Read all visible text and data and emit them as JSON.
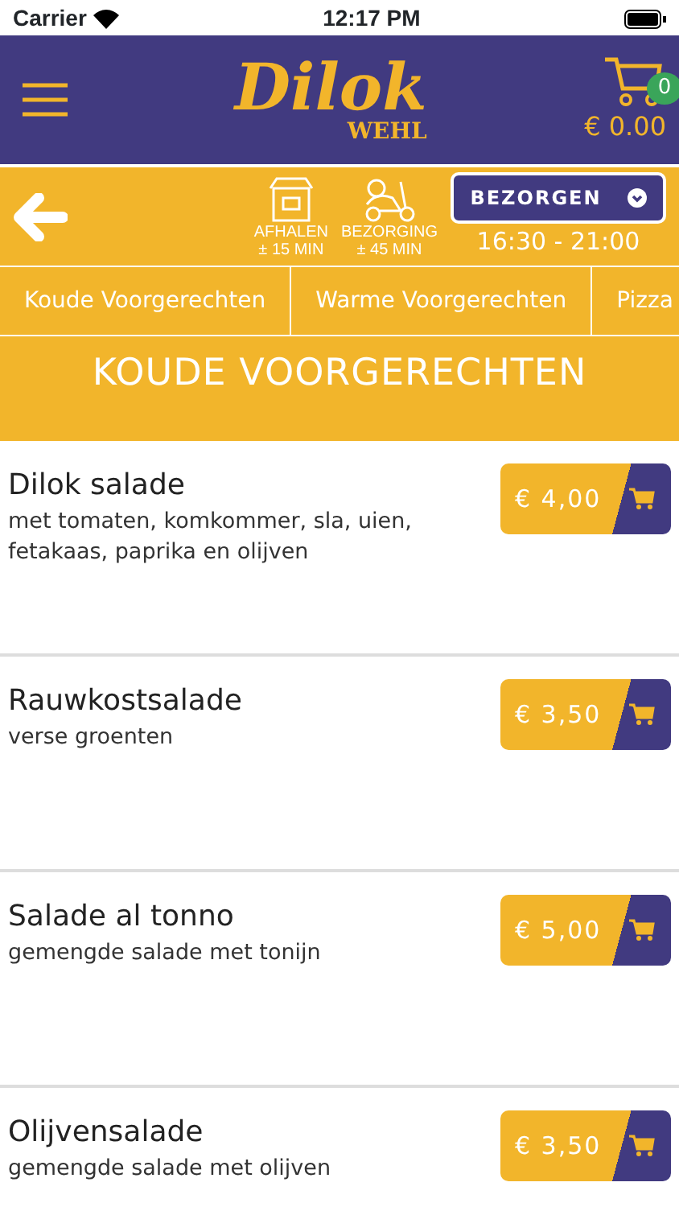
{
  "status_bar": {
    "carrier": "Carrier",
    "time": "12:17 PM"
  },
  "header": {
    "logo": "Dilok",
    "logo_sub": "WEHL",
    "cart_count": "0",
    "cart_total": "€ 0.00"
  },
  "order_bar": {
    "options": [
      {
        "kind": "pickup",
        "label": "AFHALEN",
        "time": "± 15 MIN"
      },
      {
        "kind": "delivery",
        "label": "BEZORGING",
        "time": "± 45 MIN"
      }
    ],
    "mode_button": "BEZORGEN",
    "hours": "16:30 - 21:00"
  },
  "categories": [
    "Koude Voorgerechten",
    "Warme Voorgerechten",
    "Pizza"
  ],
  "section_title": "KOUDE VOORGERECHTEN",
  "items": [
    {
      "name": "Dilok salade",
      "description": "met tomaten, komkommer, sla, uien, fetakaas, paprika en olijven",
      "price": "€ 4,00"
    },
    {
      "name": "Rauwkostsalade",
      "description": "verse groenten",
      "price": "€ 3,50"
    },
    {
      "name": "Salade al tonno",
      "description": "gemengde salade met tonijn",
      "price": "€ 5,00"
    },
    {
      "name": "Olijvensalade",
      "description": "gemengde salade met olijven",
      "price": "€ 3,50"
    }
  ]
}
